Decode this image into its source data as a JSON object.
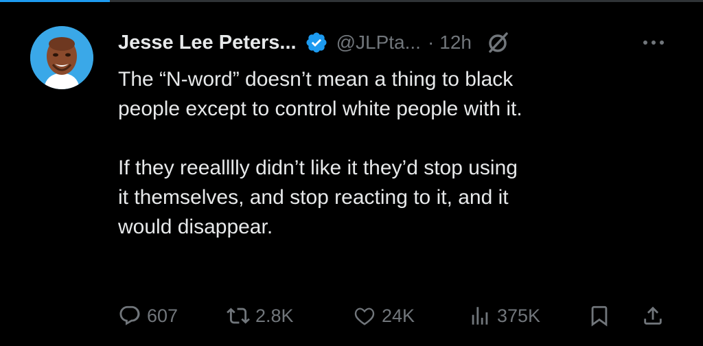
{
  "tweet": {
    "author_name": "Jesse Lee Peters...",
    "handle": "@JLPta...",
    "separator": "·",
    "time": "12h",
    "paragraphs": [
      "The “N-word” doesn’t mean a thing to black\npeople except to control white people with it.",
      "If they reealllly didn’t like it they’d stop using\nit themselves, and stop reacting to it, and it\nwould disappear."
    ]
  },
  "actions": {
    "replies": "607",
    "reposts": "2.8K",
    "likes": "24K",
    "views": "375K"
  },
  "icons": {
    "verified": "verified-badge-icon",
    "grok": "grok-icon",
    "more": "more-icon",
    "reply": "reply-icon",
    "repost": "repost-icon",
    "like": "heart-icon",
    "views": "views-icon",
    "bookmark": "bookmark-icon",
    "share": "share-icon"
  },
  "colors": {
    "background": "#000000",
    "text_primary": "#e7e9ea",
    "text_secondary": "#71767b",
    "accent": "#1d9bf0",
    "avatar_bg": "#3aa8e8"
  }
}
